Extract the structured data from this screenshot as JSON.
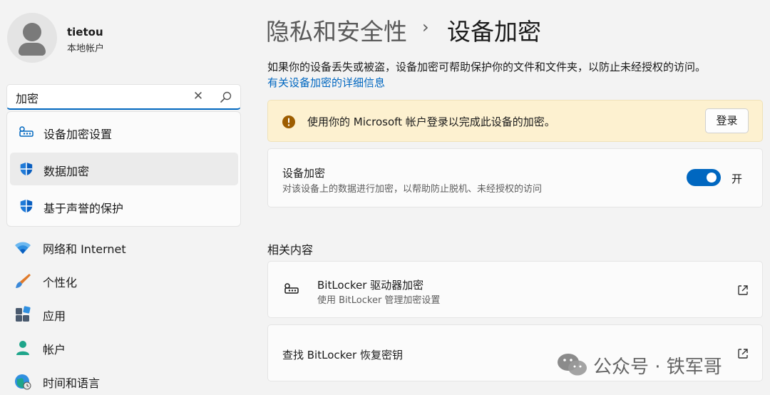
{
  "user": {
    "name": "tietou",
    "account_type": "本地帐户"
  },
  "search": {
    "value": "加密",
    "placeholder": ""
  },
  "suggestions": [
    {
      "label": "设备加密设置",
      "icon": "key-icon"
    },
    {
      "label": "数据加密",
      "icon": "shield-icon"
    },
    {
      "label": "基于声誉的保护",
      "icon": "shield-icon"
    }
  ],
  "nav": [
    {
      "label": "网络和 Internet",
      "icon": "wifi-icon"
    },
    {
      "label": "个性化",
      "icon": "brush-icon"
    },
    {
      "label": "应用",
      "icon": "apps-icon"
    },
    {
      "label": "帐户",
      "icon": "person-icon"
    },
    {
      "label": "时间和语言",
      "icon": "globe-clock-icon"
    }
  ],
  "breadcrumb": {
    "parent": "隐私和安全性",
    "separator": "›",
    "current": "设备加密"
  },
  "description": "如果你的设备丢失或被盗，设备加密可帮助保护你的文件和文件夹，以防止未经授权的访问。",
  "info_link": "有关设备加密的详细信息",
  "warning": {
    "message": "使用你的 Microsoft 帐户登录以完成此设备的加密。",
    "button": "登录",
    "icon": "warning-icon"
  },
  "encryption": {
    "title": "设备加密",
    "subtitle": "对该设备上的数据进行加密，以帮助防止脱机、未经授权的访问",
    "toggle_on": true,
    "toggle_state": "开"
  },
  "related": {
    "heading": "相关内容",
    "bitlocker": {
      "title": "BitLocker 驱动器加密",
      "subtitle": "使用 BitLocker 管理加密设置"
    },
    "recovery": {
      "title": "查找 BitLocker 恢复密钥"
    }
  },
  "watermark": {
    "text": "公众号 · 铁军哥"
  },
  "colors": {
    "accent": "#0067c0",
    "warning_bg": "#fdf1d0",
    "warning_icon": "#9d5d00"
  }
}
